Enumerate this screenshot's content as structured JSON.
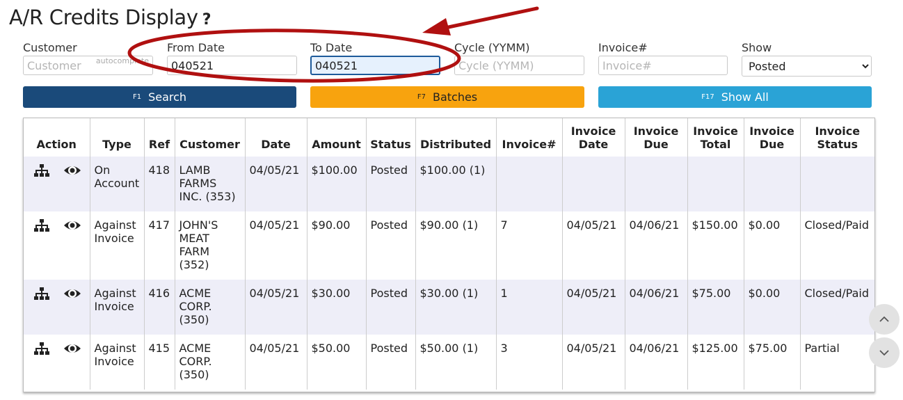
{
  "page": {
    "title": "A/R Credits Display",
    "help": "?"
  },
  "filters": {
    "customer": {
      "label": "Customer",
      "value": "",
      "placeholder": "Customer",
      "hint": "autocomplete"
    },
    "from_date": {
      "label": "From Date",
      "value": "040521",
      "placeholder": ""
    },
    "to_date": {
      "label": "To Date",
      "value": "040521",
      "placeholder": ""
    },
    "cycle": {
      "label": "Cycle (YYMM)",
      "value": "",
      "placeholder": "Cycle (YYMM)"
    },
    "invoice": {
      "label": "Invoice#",
      "value": "",
      "placeholder": "Invoice#"
    },
    "show": {
      "label": "Show",
      "selected": "Posted"
    }
  },
  "buttons": {
    "search": {
      "key": "F1",
      "label": "Search"
    },
    "batches": {
      "key": "F7",
      "label": "Batches"
    },
    "show_all": {
      "key": "F17",
      "label": "Show All"
    }
  },
  "table": {
    "headers": [
      "Action",
      "Type",
      "Ref",
      "Customer",
      "Date",
      "Amount",
      "Status",
      "Distributed",
      "Invoice#",
      "Invoice Date",
      "Invoice Due",
      "Invoice Total",
      "Invoice Due",
      "Invoice Status"
    ],
    "rows": [
      {
        "type": "On Account",
        "ref": "418",
        "customer": "LAMB FARMS INC. (353)",
        "date": "04/05/21",
        "amount": "$100.00",
        "status": "Posted",
        "distributed": "$100.00 (1)",
        "invoice": "",
        "invoice_date": "",
        "invoice_due_date": "",
        "invoice_total": "",
        "invoice_due": "",
        "invoice_status": ""
      },
      {
        "type": "Against Invoice",
        "ref": "417",
        "customer": "JOHN'S MEAT FARM (352)",
        "date": "04/05/21",
        "amount": "$90.00",
        "status": "Posted",
        "distributed": "$90.00 (1)",
        "invoice": "7",
        "invoice_date": "04/05/21",
        "invoice_due_date": "04/06/21",
        "invoice_total": "$150.00",
        "invoice_due": "$0.00",
        "invoice_status": "Closed/Paid"
      },
      {
        "type": "Against Invoice",
        "ref": "416",
        "customer": "ACME CORP. (350)",
        "date": "04/05/21",
        "amount": "$30.00",
        "status": "Posted",
        "distributed": "$30.00 (1)",
        "invoice": "1",
        "invoice_date": "04/05/21",
        "invoice_due_date": "04/06/21",
        "invoice_total": "$75.00",
        "invoice_due": "$0.00",
        "invoice_status": "Closed/Paid"
      },
      {
        "type": "Against Invoice",
        "ref": "415",
        "customer": "ACME CORP. (350)",
        "date": "04/05/21",
        "amount": "$50.00",
        "status": "Posted",
        "distributed": "$50.00 (1)",
        "invoice": "3",
        "invoice_date": "04/05/21",
        "invoice_due_date": "04/06/21",
        "invoice_total": "$125.00",
        "invoice_due": "$75.00",
        "invoice_status": "Partial"
      }
    ]
  },
  "icons": {
    "hierarchy": "hierarchy-icon",
    "view": "eye-icon",
    "scroll_up": "chevron-up-icon",
    "scroll_down": "chevron-down-icon"
  },
  "colors": {
    "search": "#1a4a7a",
    "batches": "#f8a30e",
    "show_all": "#2aa3d6",
    "annotation": "#b01010",
    "row_alt": "#eeeef8"
  }
}
